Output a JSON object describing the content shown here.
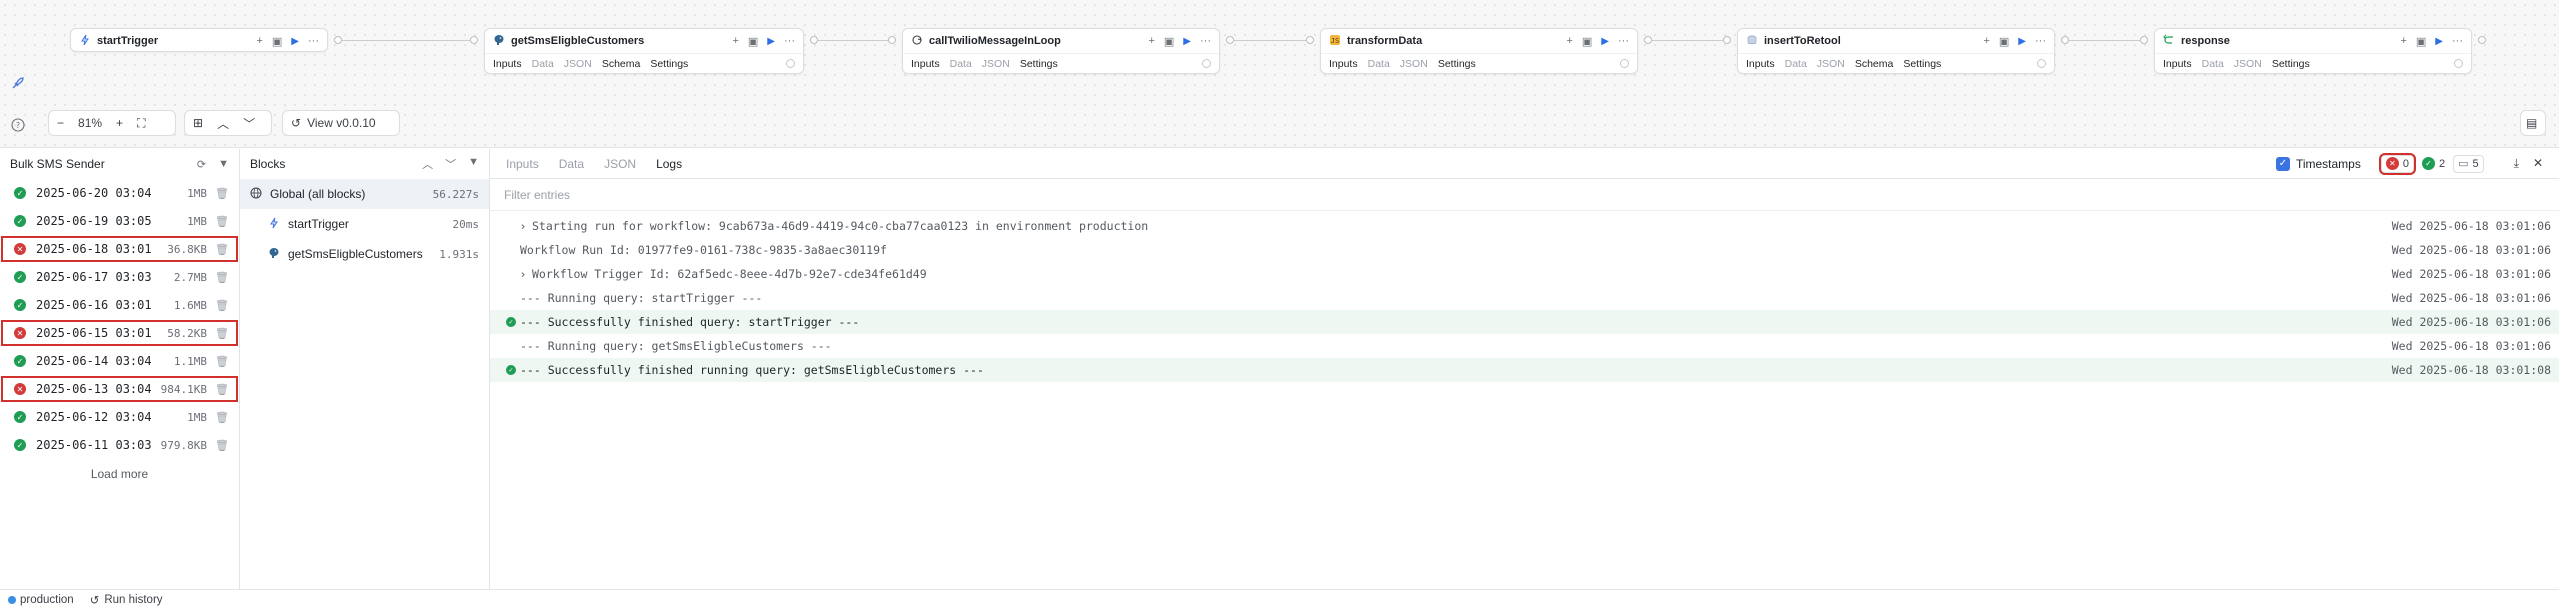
{
  "canvas": {
    "nodes": [
      {
        "title": "startTrigger",
        "icon": "bolt-icon",
        "tabs": []
      },
      {
        "title": "getSmsEligbleCustomers",
        "icon": "postgres-icon",
        "tabs": [
          {
            "label": "Inputs",
            "on": true
          },
          {
            "label": "Data",
            "on": false
          },
          {
            "label": "JSON",
            "on": false
          },
          {
            "label": "Schema",
            "on": true
          },
          {
            "label": "Settings",
            "on": true
          }
        ]
      },
      {
        "title": "callTwilioMessageInLoop",
        "icon": "loop-icon",
        "tabs": [
          {
            "label": "Inputs",
            "on": true
          },
          {
            "label": "Data",
            "on": false
          },
          {
            "label": "JSON",
            "on": false
          },
          {
            "label": "Settings",
            "on": true
          }
        ]
      },
      {
        "title": "transformData",
        "icon": "code-icon",
        "tabs": [
          {
            "label": "Inputs",
            "on": true
          },
          {
            "label": "Data",
            "on": false
          },
          {
            "label": "JSON",
            "on": false
          },
          {
            "label": "Settings",
            "on": true
          }
        ]
      },
      {
        "title": "insertToRetool",
        "icon": "database-icon",
        "tabs": [
          {
            "label": "Inputs",
            "on": true
          },
          {
            "label": "Data",
            "on": false
          },
          {
            "label": "JSON",
            "on": false
          },
          {
            "label": "Schema",
            "on": true
          },
          {
            "label": "Settings",
            "on": true
          }
        ]
      },
      {
        "title": "response",
        "icon": "return-icon",
        "tabs": [
          {
            "label": "Inputs",
            "on": true
          },
          {
            "label": "Data",
            "on": false
          },
          {
            "label": "JSON",
            "on": false
          },
          {
            "label": "Settings",
            "on": true
          }
        ]
      }
    ],
    "zoom": "81%",
    "view_label": "View v0.0.10"
  },
  "runs": {
    "title": "Bulk SMS Sender",
    "items": [
      {
        "date": "2025-06-20 03:04",
        "size": "1MB",
        "status": "success"
      },
      {
        "date": "2025-06-19 03:05",
        "size": "1MB",
        "status": "success"
      },
      {
        "date": "2025-06-18 03:01",
        "size": "36.8KB",
        "status": "error"
      },
      {
        "date": "2025-06-17 03:03",
        "size": "2.7MB",
        "status": "success"
      },
      {
        "date": "2025-06-16 03:01",
        "size": "1.6MB",
        "status": "success"
      },
      {
        "date": "2025-06-15 03:01",
        "size": "58.2KB",
        "status": "error"
      },
      {
        "date": "2025-06-14 03:04",
        "size": "1.1MB",
        "status": "success"
      },
      {
        "date": "2025-06-13 03:04",
        "size": "984.1KB",
        "status": "error"
      },
      {
        "date": "2025-06-12 03:04",
        "size": "1MB",
        "status": "success"
      },
      {
        "date": "2025-06-11 03:03",
        "size": "979.8KB",
        "status": "success"
      }
    ],
    "load_more": "Load more"
  },
  "blocks": {
    "title": "Blocks",
    "items": [
      {
        "name": "Global (all blocks)",
        "duration": "56.227s",
        "icon": "globe-icon",
        "selected": true
      },
      {
        "name": "startTrigger",
        "duration": "20ms",
        "icon": "bolt-icon",
        "selected": false
      },
      {
        "name": "getSmsEligbleCustomers",
        "duration": "1.931s",
        "icon": "postgres-icon",
        "selected": false
      }
    ]
  },
  "logs": {
    "tabs": [
      {
        "label": "Inputs",
        "on": false
      },
      {
        "label": "Data",
        "on": false
      },
      {
        "label": "JSON",
        "on": false
      },
      {
        "label": "Logs",
        "on": true
      }
    ],
    "timestamps_label": "Timestamps",
    "error_count": "0",
    "success_count": "2",
    "message_count": "5",
    "filter_placeholder": "Filter entries",
    "entries": [
      {
        "prefix": "chevron",
        "text": "Starting run for workflow: 9cab673a-46d9-4419-94c0-cba77caa0123 in environment production",
        "ts": "Wed 2025-06-18 03:01:06",
        "ok": false
      },
      {
        "prefix": "",
        "text": "Workflow Run Id: 01977fe9-0161-738c-9835-3a8aec30119f",
        "ts": "Wed 2025-06-18 03:01:06",
        "ok": false
      },
      {
        "prefix": "chevron",
        "text": "Workflow Trigger Id: 62af5edc-8eee-4d7b-92e7-cde34fe61d49",
        "ts": "Wed 2025-06-18 03:01:06",
        "ok": false
      },
      {
        "prefix": "",
        "text": "--- Running query: startTrigger ---",
        "ts": "Wed 2025-06-18 03:01:06",
        "ok": false
      },
      {
        "prefix": "check",
        "text": "--- Successfully finished query: startTrigger ---",
        "ts": "Wed 2025-06-18 03:01:06",
        "ok": true
      },
      {
        "prefix": "",
        "text": "--- Running query: getSmsEligbleCustomers ---",
        "ts": "Wed 2025-06-18 03:01:06",
        "ok": false
      },
      {
        "prefix": "check",
        "text": "--- Successfully finished running query: getSmsEligbleCustomers ---",
        "ts": "Wed 2025-06-18 03:01:08",
        "ok": true
      }
    ]
  },
  "footer": {
    "environment": "production",
    "run_history": "Run history"
  }
}
